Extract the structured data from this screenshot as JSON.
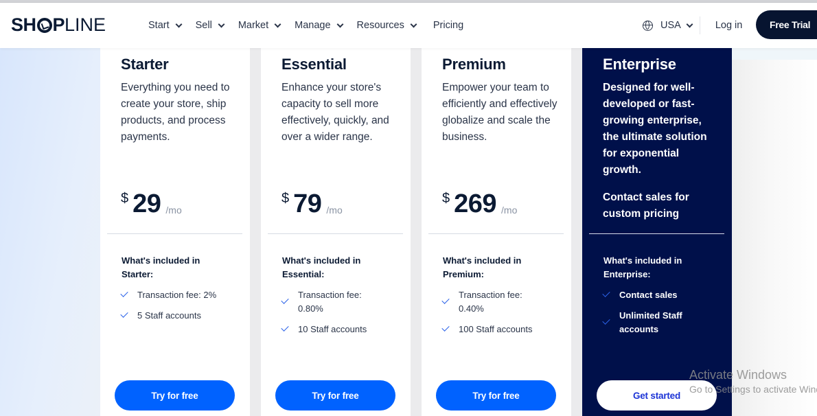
{
  "header": {
    "logo": {
      "bold": "SH",
      "bold_after": "P",
      "thin": "LINE",
      "full": "SHOPLINE"
    },
    "nav": [
      {
        "label": "Start",
        "has_dropdown": true
      },
      {
        "label": "Sell",
        "has_dropdown": true
      },
      {
        "label": "Market",
        "has_dropdown": true
      },
      {
        "label": "Manage",
        "has_dropdown": true
      },
      {
        "label": "Resources",
        "has_dropdown": true
      },
      {
        "label": "Pricing",
        "has_dropdown": false
      }
    ],
    "country_icon": "globe-icon",
    "country": "USA",
    "login": "Log in",
    "free_trial": "Free Trial"
  },
  "plans": [
    {
      "name": "Starter",
      "description": "Everything you need to create your store, ship products, and process payments.",
      "currency": "$",
      "price": "29",
      "period": "/mo",
      "included_title": "What's included in Starter:",
      "features": [
        "Transaction fee: 2%",
        "5 Staff accounts"
      ],
      "cta": "Try for free"
    },
    {
      "name": "Essential",
      "description": "Enhance your store's capacity to sell more effectively, quickly, and over a wider range.",
      "currency": "$",
      "price": "79",
      "period": "/mo",
      "included_title": "What's included in Essential:",
      "features": [
        "Transaction fee: 0.80%",
        "10 Staff accounts"
      ],
      "cta": "Try for free"
    },
    {
      "name": "Premium",
      "description": "Empower your team to efficiently and effectively globalize and scale the business.",
      "currency": "$",
      "price": "269",
      "period": "/mo",
      "included_title": "What's included in Premium:",
      "features": [
        "Transaction fee: 0.40%",
        "100 Staff accounts"
      ],
      "cta": "Try for free"
    },
    {
      "name": "Enterprise",
      "description": "Designed for well-developed or fast-growing enterprise, the ultimate solution for exponential growth.",
      "contact": "Contact sales for custom pricing",
      "included_title": "What's included in Enterprise:",
      "features": [
        "Contact sales",
        "Unlimited Staff accounts"
      ],
      "cta": "Get started"
    }
  ],
  "colors": {
    "primary_button": "#0062ff",
    "enterprise_bg": "#00104a",
    "dark_navy": "#071430",
    "check": "#2b62e8"
  },
  "watermark": {
    "line1": "Activate Windows",
    "line2": "Go to Settings to activate Windows."
  }
}
